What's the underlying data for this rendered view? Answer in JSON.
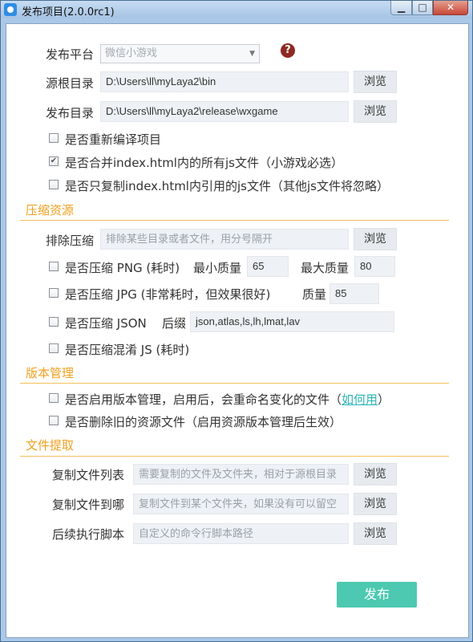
{
  "window": {
    "title": "发布项目(2.0.0rc1)",
    "minimize": "▁",
    "maximize": "□",
    "close": "✕"
  },
  "platform": {
    "label": "发布平台",
    "value": "微信小游戏"
  },
  "source_dir": {
    "label": "源根目录",
    "value": "D:\\Users\\ll\\myLaya2\\bin",
    "browse": "浏览"
  },
  "publish_dir": {
    "label": "发布目录",
    "value": "D:\\Users\\ll\\myLaya2\\release\\wxgame",
    "browse": "浏览"
  },
  "options": {
    "recompile": {
      "label": "是否重新编译项目",
      "checked": false
    },
    "merge_js": {
      "label": "是否合并index.html内的所有js文件（小游戏必选）",
      "checked": true
    },
    "copy_only_js": {
      "label": "是否只复制index.html内引用的js文件（其他js文件将忽略）",
      "checked": false
    }
  },
  "compress": {
    "section_title": "压缩资源",
    "exclude": {
      "label": "排除压缩",
      "placeholder": "排除某些目录或者文件，用分号隔开",
      "browse": "浏览"
    },
    "png": {
      "label": "是否压缩 PNG (耗时)",
      "min_label": "最小质量",
      "min_value": "65",
      "max_label": "最大质量",
      "max_value": "80"
    },
    "jpg": {
      "label": "是否压缩 JPG (非常耗时，但效果很好)",
      "quality_label": "质量",
      "quality_value": "85"
    },
    "json": {
      "label": "是否压缩 JSON",
      "suffix_label": "后缀",
      "suffix_value": "json,atlas,ls,lh,lmat,lav"
    },
    "js": {
      "label": "是否压缩混淆 JS (耗时)"
    }
  },
  "version": {
    "section_title": "版本管理",
    "enable": {
      "label": "是否启用版本管理，启用后，会重命名变化的文件（",
      "link": "如何用",
      "tail": "）"
    },
    "delete_old": {
      "label": "是否删除旧的资源文件（启用资源版本管理后生效）"
    }
  },
  "files": {
    "section_title": "文件提取",
    "copy_list": {
      "label": "复制文件列表",
      "placeholder": "需要复制的文件及文件夹，相对于源根目录",
      "browse": "浏览"
    },
    "copy_to": {
      "label": "复制文件到哪",
      "placeholder": "复制文件到某个文件夹，如果没有可以留空",
      "browse": "浏览"
    },
    "post_script": {
      "label": "后续执行脚本",
      "placeholder": "自定义的命令行脚本路径",
      "browse": "浏览"
    }
  },
  "publish_button": "发布",
  "colors": {
    "accent": "#f0a020",
    "primary_button": "#4cc9b0",
    "link": "#2bb4b4"
  },
  "icons": {
    "help": "question-circle-icon",
    "app": "laya-app-icon"
  }
}
